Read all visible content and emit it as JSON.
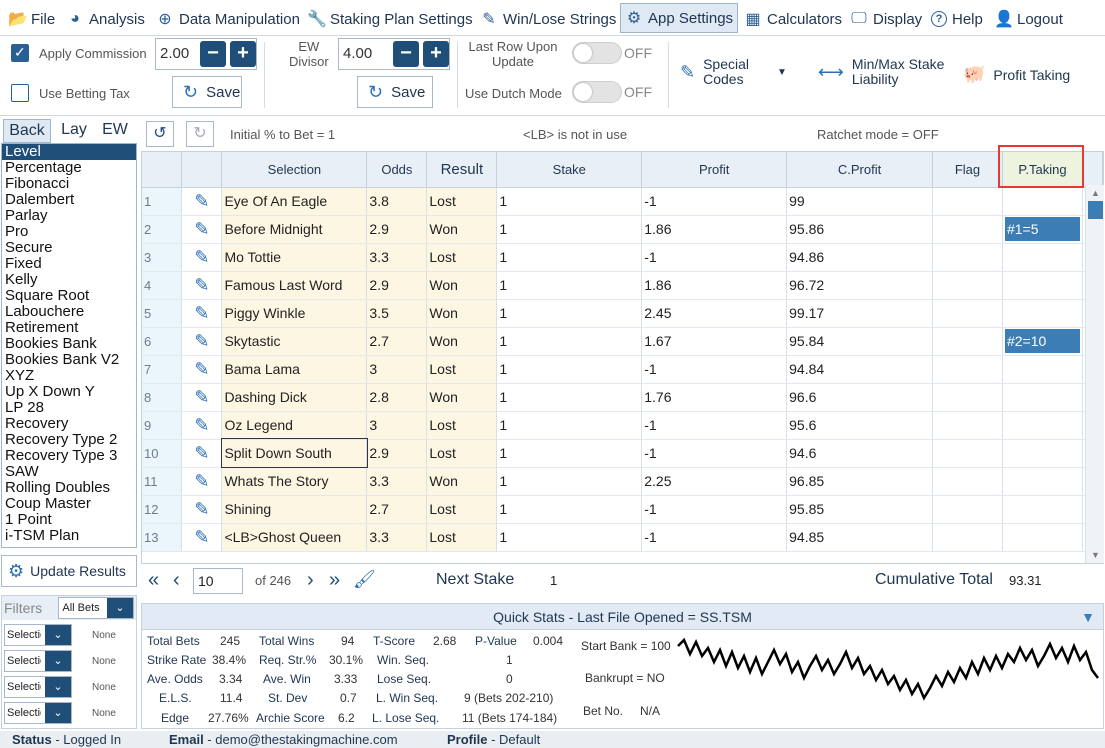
{
  "menu": [
    {
      "label": "File",
      "icon": "folder-open-icon",
      "glyph": "📂"
    },
    {
      "label": "Analysis",
      "icon": "pie-chart-icon",
      "glyph": "◕"
    },
    {
      "label": "Data Manipulation",
      "icon": "plus-circle-icon",
      "glyph": "⊕"
    },
    {
      "label": "Staking Plan Settings",
      "icon": "wrench-icon",
      "glyph": "🔧"
    },
    {
      "label": "Win/Lose Strings",
      "icon": "edit-icon",
      "glyph": "✎"
    },
    {
      "label": "App Settings",
      "icon": "gear-icon",
      "glyph": "⚙"
    },
    {
      "label": "Calculators",
      "icon": "calculator-icon",
      "glyph": "▦"
    },
    {
      "label": "Display",
      "icon": "monitor-icon",
      "glyph": "🖵"
    },
    {
      "label": "Help",
      "icon": "help-icon",
      "glyph": "?"
    },
    {
      "label": "Logout",
      "icon": "user-icon",
      "glyph": "👤"
    }
  ],
  "settings": {
    "apply_commission": "Apply Commission",
    "commission_value": "2.00",
    "use_betting_tax": "Use Betting Tax",
    "ew_divisor": "EW\nDivisor",
    "ew_divisor_l1": "EW",
    "ew_divisor_l2": "Divisor",
    "ew_value": "4.00",
    "save": "Save",
    "last_row_l1": "Last Row Upon",
    "last_row_l2": "Update",
    "use_dutch": "Use Dutch Mode",
    "off": "OFF",
    "special_codes_l1": "Special",
    "special_codes_l2": "Codes",
    "minmax_l1": "Min/Max Stake",
    "minmax_l2": "Liability",
    "profit_taking": "Profit Taking"
  },
  "tabs": [
    "Back",
    "Lay",
    "EW"
  ],
  "plans": [
    "Level",
    "Percentage",
    "Fibonacci",
    "Dalembert",
    "Parlay",
    "Pro",
    "Secure",
    "Fixed",
    "Kelly",
    "Square Root",
    "Labouchere",
    "Retirement",
    "Bookies Bank",
    "Bookies Bank V2",
    "XYZ",
    "Up X Down Y",
    "LP 28",
    "Recovery",
    "Recovery Type 2",
    "Recovery Type 3",
    "SAW",
    "Rolling Doubles",
    "Coup Master",
    "1 Point",
    "i-TSM Plan"
  ],
  "update_results": "Update Results",
  "filters": {
    "label": "Filters",
    "all_bets": "All Bets",
    "sel": "Selectio",
    "none": "None"
  },
  "grid_info": {
    "initial": "Initial % to Bet = 1",
    "lb": "<LB> is not in use",
    "ratchet": "Ratchet mode = OFF"
  },
  "columns": [
    "Selection",
    "Odds",
    "Result",
    "Stake",
    "Profit",
    "C.Profit",
    "Flag",
    "P.Taking"
  ],
  "rows": [
    {
      "n": "1",
      "sel": "Eye Of An Eagle",
      "odds": "3.8",
      "res": "Lost",
      "stake": "1",
      "profit": "-1",
      "cp": "99",
      "pt": ""
    },
    {
      "n": "2",
      "sel": "Before Midnight",
      "odds": "2.9",
      "res": "Won",
      "stake": "1",
      "profit": "1.86",
      "cp": "95.86",
      "pt": "#1=5"
    },
    {
      "n": "3",
      "sel": "Mo Tottie",
      "odds": "3.3",
      "res": "Lost",
      "stake": "1",
      "profit": "-1",
      "cp": "94.86",
      "pt": ""
    },
    {
      "n": "4",
      "sel": "Famous Last Word",
      "odds": "2.9",
      "res": "Won",
      "stake": "1",
      "profit": "1.86",
      "cp": "96.72",
      "pt": ""
    },
    {
      "n": "5",
      "sel": "Piggy Winkle",
      "odds": "3.5",
      "res": "Won",
      "stake": "1",
      "profit": "2.45",
      "cp": "99.17",
      "pt": ""
    },
    {
      "n": "6",
      "sel": "Skytastic",
      "odds": "2.7",
      "res": "Won",
      "stake": "1",
      "profit": "1.67",
      "cp": "95.84",
      "pt": "#2=10"
    },
    {
      "n": "7",
      "sel": "Bama Lama",
      "odds": "3",
      "res": "Lost",
      "stake": "1",
      "profit": "-1",
      "cp": "94.84",
      "pt": ""
    },
    {
      "n": "8",
      "sel": "Dashing Dick",
      "odds": "2.8",
      "res": "Won",
      "stake": "1",
      "profit": "1.76",
      "cp": "96.6",
      "pt": ""
    },
    {
      "n": "9",
      "sel": "Oz Legend",
      "odds": "3",
      "res": "Lost",
      "stake": "1",
      "profit": "-1",
      "cp": "95.6",
      "pt": ""
    },
    {
      "n": "10",
      "sel": "Split Down South",
      "odds": "2.9",
      "res": "Lost",
      "stake": "1",
      "profit": "-1",
      "cp": "94.6",
      "pt": ""
    },
    {
      "n": "11",
      "sel": "Whats The Story",
      "odds": "3.3",
      "res": "Won",
      "stake": "1",
      "profit": "2.25",
      "cp": "96.85",
      "pt": ""
    },
    {
      "n": "12",
      "sel": "Shining",
      "odds": "2.7",
      "res": "Lost",
      "stake": "1",
      "profit": "-1",
      "cp": "95.85",
      "pt": ""
    },
    {
      "n": "13",
      "sel": "<LB>Ghost Queen",
      "odds": "3.3",
      "res": "Lost",
      "stake": "1",
      "profit": "-1",
      "cp": "94.85",
      "pt": ""
    }
  ],
  "pager": {
    "page": "10",
    "of": "of 246",
    "next_stake_label": "Next Stake",
    "next_stake": "1",
    "cum_label": "Cumulative Total",
    "cum": "93.31"
  },
  "quick_stats": {
    "title": "Quick Stats - Last File Opened = SS.TSM",
    "total_bets_l": "Total Bets",
    "total_bets": "245",
    "total_wins_l": "Total Wins",
    "total_wins": "94",
    "tscore_l": "T-Score",
    "tscore": "2.68",
    "pvalue_l": "P-Value",
    "pvalue": "0.004",
    "strike_l": "Strike Rate",
    "strike": "38.4%",
    "reqstr_l": "Req. Str.%",
    "reqstr": "30.1%",
    "winseq_l": "Win. Seq.",
    "winseq": "1",
    "aveodds_l": "Ave. Odds",
    "aveodds": "3.34",
    "avewin_l": "Ave. Win",
    "avewin": "3.33",
    "loseseq_l": "Lose Seq.",
    "loseseq": "0",
    "els_l": "E.L.S.",
    "els": "11.4",
    "stdev_l": "St. Dev",
    "stdev": "0.7",
    "lwinseq_l": "L. Win Seq.",
    "lwinseq": "9 (Bets 202-210)",
    "edge_l": "Edge",
    "edge": "27.76%",
    "archie_l": "Archie Score",
    "archie": "6.2",
    "lloseseq_l": "L. Lose Seq.",
    "lloseseq": "11 (Bets 174-184)",
    "start_bank": "Start Bank = 100",
    "bankrupt": "Bankrupt = NO",
    "bet_no_l": "Bet No.",
    "bet_no": "N/A"
  },
  "status": {
    "status_l": "Status",
    "status": "Logged In",
    "email_l": "Email",
    "email": "demo@thestakingmachine.com",
    "profile_l": "Profile",
    "profile": "Default"
  }
}
